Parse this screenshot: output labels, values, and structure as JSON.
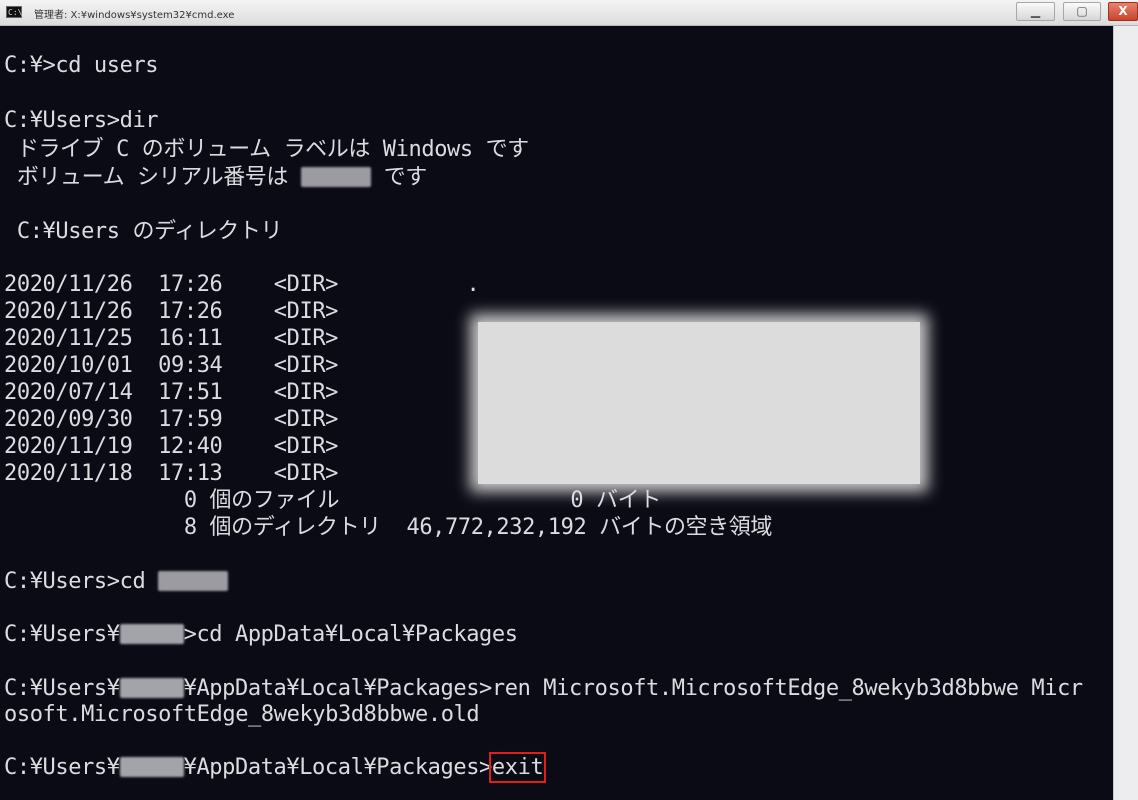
{
  "window": {
    "title": "管理者: X:¥windows¥system32¥cmd.exe",
    "icon": "cmd-icon",
    "controls": [
      "minimize-icon",
      "maximize-icon",
      "close-icon"
    ],
    "min_glyph": "▁",
    "max_glyph": "▢",
    "close_glyph": "X"
  },
  "console": {
    "l1": "C:¥>cd users",
    "l2": "C:¥Users>dir",
    "l3": " ドライブ C のボリューム ラベルは Windows です",
    "l4a": " ボリューム シリアル番号は ",
    "l4b": " です",
    "l5": " C:¥Users のディレクトリ",
    "dir_rows": [
      {
        "date": "2020/11/26",
        "time": "17:26",
        "type": "<DIR>",
        "name": "."
      },
      {
        "date": "2020/11/26",
        "time": "17:26",
        "type": "<DIR>",
        "name": ""
      },
      {
        "date": "2020/11/25",
        "time": "16:11",
        "type": "<DIR>",
        "name": ""
      },
      {
        "date": "2020/10/01",
        "time": "09:34",
        "type": "<DIR>",
        "name": ""
      },
      {
        "date": "2020/07/14",
        "time": "17:51",
        "type": "<DIR>",
        "name": ""
      },
      {
        "date": "2020/09/30",
        "time": "17:59",
        "type": "<DIR>",
        "name": ""
      },
      {
        "date": "2020/11/19",
        "time": "12:40",
        "type": "<DIR>",
        "name": ""
      },
      {
        "date": "2020/11/18",
        "time": "17:13",
        "type": "<DIR>",
        "name": ""
      }
    ],
    "summary_files": "              0 個のファイル                  0 バイト",
    "summary_dirs": "              8 個のディレクトリ  46,772,232,192 バイトの空き領域",
    "l6": "C:¥Users>cd ",
    "l7a": "C:¥Users¥",
    "l7b": ">cd AppData¥Local¥Packages",
    "l8a": "C:¥Users¥",
    "l8b": "¥AppData¥Local¥Packages>ren Microsoft.MicrosoftEdge_8wekyb3d8bbwe Micr",
    "l9": "osoft.MicrosoftEdge_8wekyb3d8bbwe.old",
    "l10a": "C:¥Users¥",
    "l10b": "¥AppData¥Local¥Packages>",
    "l10c": "exit"
  }
}
